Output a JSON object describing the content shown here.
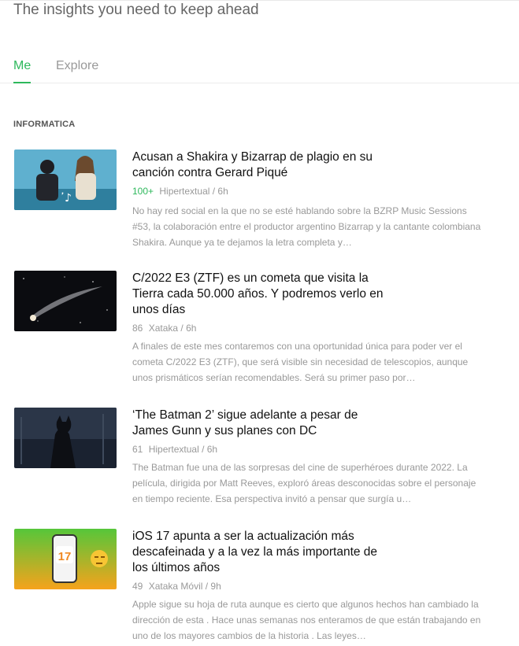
{
  "header": {
    "tagline": "The insights you need to keep ahead"
  },
  "tabs": [
    {
      "label": "Me"
    },
    {
      "label": "Explore"
    }
  ],
  "section": {
    "title": "INFORMATICA"
  },
  "articles": [
    {
      "title": "Acusan a Shakira y Bizarrap de plagio en su canción contra Gerard Piqué",
      "count": "100+",
      "source_time": "Hipertextual / 6h",
      "excerpt": "No hay red social en la que no se esté hablando sobre la BZRP Music Sessions #53, la colaboración entre el productor argentino Bizarrap y la cantante colombiana Shakira. Aunque ya te dejamos la letra completa y…",
      "thumb_icon": "music-session-thumbnail"
    },
    {
      "title": "C/2022 E3 (ZTF) es un cometa que visita la Tierra cada 50.000 años. Y podremos verlo en unos días",
      "count": "86",
      "source_time": "Xataka / 6h",
      "excerpt": "A finales de este mes contaremos con una oportunidad única para poder ver el cometa C/2022 E3 (ZTF), que será visible sin necesidad de telescopios, aunque unos prismáticos serían recomendables. Será su primer paso por…",
      "thumb_icon": "comet-thumbnail"
    },
    {
      "title": "‘The Batman 2’ sigue adelante a pesar de James Gunn y sus planes con DC",
      "count": "61",
      "source_time": "Hipertextual / 6h",
      "excerpt": "The Batman fue una de las sorpresas del cine de superhéroes durante 2022. La película, dirigida por Matt Reeves, exploró áreas desconocidas sobre el personaje en tiempo reciente. Esa perspectiva invitó a pensar que surgía u…",
      "thumb_icon": "batman-thumbnail"
    },
    {
      "title": "iOS 17 apunta a ser la actualización más descafeinada y a la vez la más importante de los últimos años",
      "count": "49",
      "source_time": "Xataka Móvil / 9h",
      "excerpt": "Apple sigue su hoja de ruta aunque es cierto que algunos hechos han cambiado la dirección de esta . Hace unas semanas nos enteramos de que están trabajando en uno de los mayores cambios de la historia . Las leyes…",
      "thumb_icon": "ios17-thumbnail"
    }
  ],
  "colors": {
    "accent": "#2eb85c",
    "muted": "#999999"
  }
}
